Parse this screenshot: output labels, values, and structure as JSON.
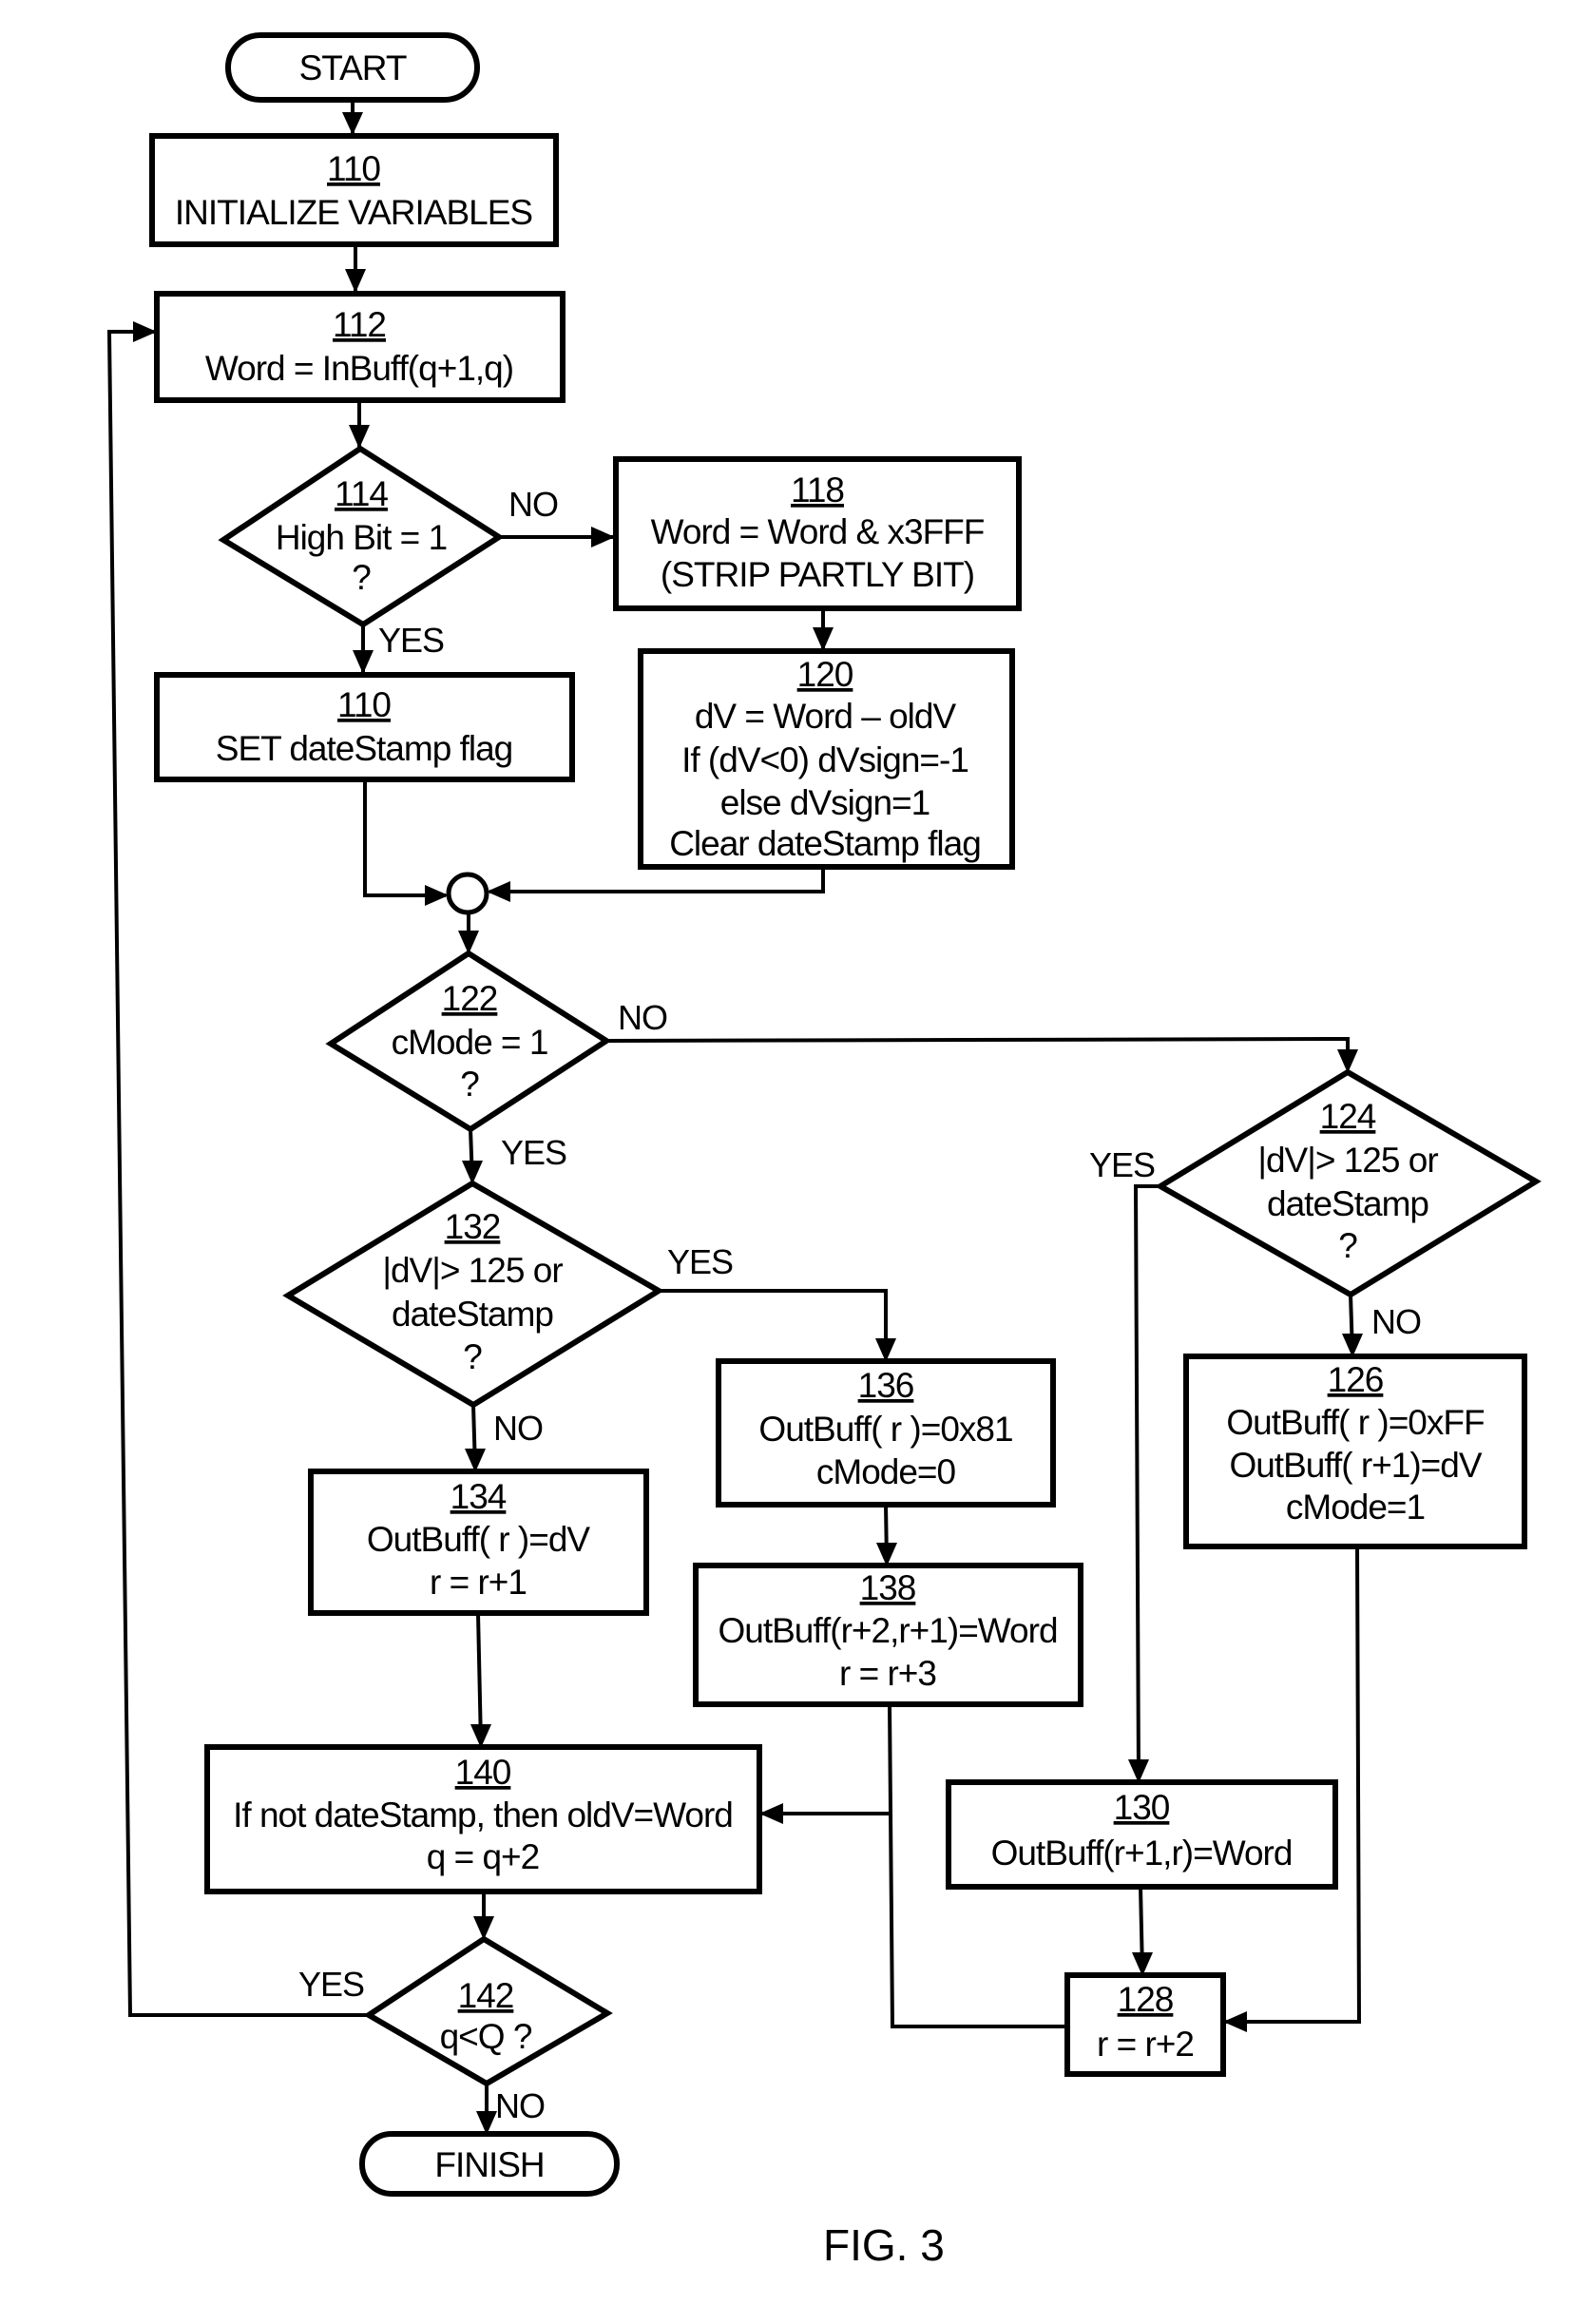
{
  "figure": {
    "caption": "FIG. 3",
    "terminals": {
      "start": "START",
      "finish": "FINISH"
    },
    "nodes": [
      {
        "id": "110a",
        "kind": "process",
        "number": "110",
        "lines": [
          "INITIALIZE VARIABLES"
        ]
      },
      {
        "id": "112",
        "kind": "process",
        "number": "112",
        "lines": [
          "Word = InBuff(q+1,q)"
        ]
      },
      {
        "id": "114",
        "kind": "decision",
        "number": "114",
        "lines": [
          "High Bit = 1",
          "?"
        ]
      },
      {
        "id": "118",
        "kind": "process",
        "number": "118",
        "lines": [
          "Word = Word & x3FFF",
          "(STRIP PARTLY BIT)"
        ]
      },
      {
        "id": "110b",
        "kind": "process",
        "number": "110",
        "lines": [
          "SET dateStamp flag"
        ]
      },
      {
        "id": "120",
        "kind": "process",
        "number": "120",
        "lines": [
          "dV = Word – oldV",
          "If (dV<0) dVsign=-1",
          "else dVsign=1",
          "Clear dateStamp flag"
        ]
      },
      {
        "id": "122",
        "kind": "decision",
        "number": "122",
        "lines": [
          "cMode = 1",
          "?"
        ]
      },
      {
        "id": "124",
        "kind": "decision",
        "number": "124",
        "lines": [
          "|dV|> 125 or",
          "dateStamp",
          "?"
        ]
      },
      {
        "id": "132",
        "kind": "decision",
        "number": "132",
        "lines": [
          "|dV|> 125 or",
          "dateStamp",
          "?"
        ]
      },
      {
        "id": "134",
        "kind": "process",
        "number": "134",
        "lines": [
          "OutBuff( r )=dV",
          "r = r+1"
        ]
      },
      {
        "id": "136",
        "kind": "process",
        "number": "136",
        "lines": [
          "OutBuff( r )=0x81",
          "cMode=0"
        ]
      },
      {
        "id": "138",
        "kind": "process",
        "number": "138",
        "lines": [
          "OutBuff(r+2,r+1)=Word",
          "r = r+3"
        ]
      },
      {
        "id": "126",
        "kind": "process",
        "number": "126",
        "lines": [
          "OutBuff( r )=0xFF",
          "OutBuff( r+1)=dV",
          "cMode=1"
        ]
      },
      {
        "id": "140",
        "kind": "process",
        "number": "140",
        "lines": [
          "If not dateStamp, then oldV=Word",
          "q = q+2"
        ]
      },
      {
        "id": "130",
        "kind": "process",
        "number": "130",
        "lines": [
          "OutBuff(r+1,r)=Word"
        ]
      },
      {
        "id": "128",
        "kind": "process",
        "number": "128",
        "lines": [
          "r = r+2"
        ]
      },
      {
        "id": "142",
        "kind": "decision",
        "number": "142",
        "lines": [
          "q<Q ?"
        ]
      }
    ],
    "branch_labels": {
      "b114_no": "NO",
      "b114_yes": "YES",
      "b122_no": "NO",
      "b122_yes": "YES",
      "b124_yes": "YES",
      "b124_no": "NO",
      "b132_yes": "YES",
      "b132_no": "NO",
      "b142_yes": "YES",
      "b142_no": "NO"
    },
    "edges": [
      {
        "from": "START",
        "to": "110a"
      },
      {
        "from": "110a",
        "to": "112"
      },
      {
        "from": "112",
        "to": "114"
      },
      {
        "from": "114",
        "to": "118",
        "label": "NO"
      },
      {
        "from": "114",
        "to": "110b",
        "label": "YES"
      },
      {
        "from": "118",
        "to": "120"
      },
      {
        "from": "110b",
        "to": "merge"
      },
      {
        "from": "120",
        "to": "merge"
      },
      {
        "from": "merge",
        "to": "122"
      },
      {
        "from": "122",
        "to": "124",
        "label": "NO"
      },
      {
        "from": "122",
        "to": "132",
        "label": "YES"
      },
      {
        "from": "132",
        "to": "136",
        "label": "YES"
      },
      {
        "from": "132",
        "to": "134",
        "label": "NO"
      },
      {
        "from": "136",
        "to": "138"
      },
      {
        "from": "124",
        "to": "130",
        "label": "YES"
      },
      {
        "from": "124",
        "to": "126",
        "label": "NO"
      },
      {
        "from": "134",
        "to": "140"
      },
      {
        "from": "138",
        "to": "140"
      },
      {
        "from": "138",
        "to": "128"
      },
      {
        "from": "130",
        "to": "128"
      },
      {
        "from": "126",
        "to": "128"
      },
      {
        "from": "140",
        "to": "142"
      },
      {
        "from": "142",
        "to": "112",
        "label": "YES"
      },
      {
        "from": "142",
        "to": "FINISH",
        "label": "NO"
      }
    ]
  }
}
